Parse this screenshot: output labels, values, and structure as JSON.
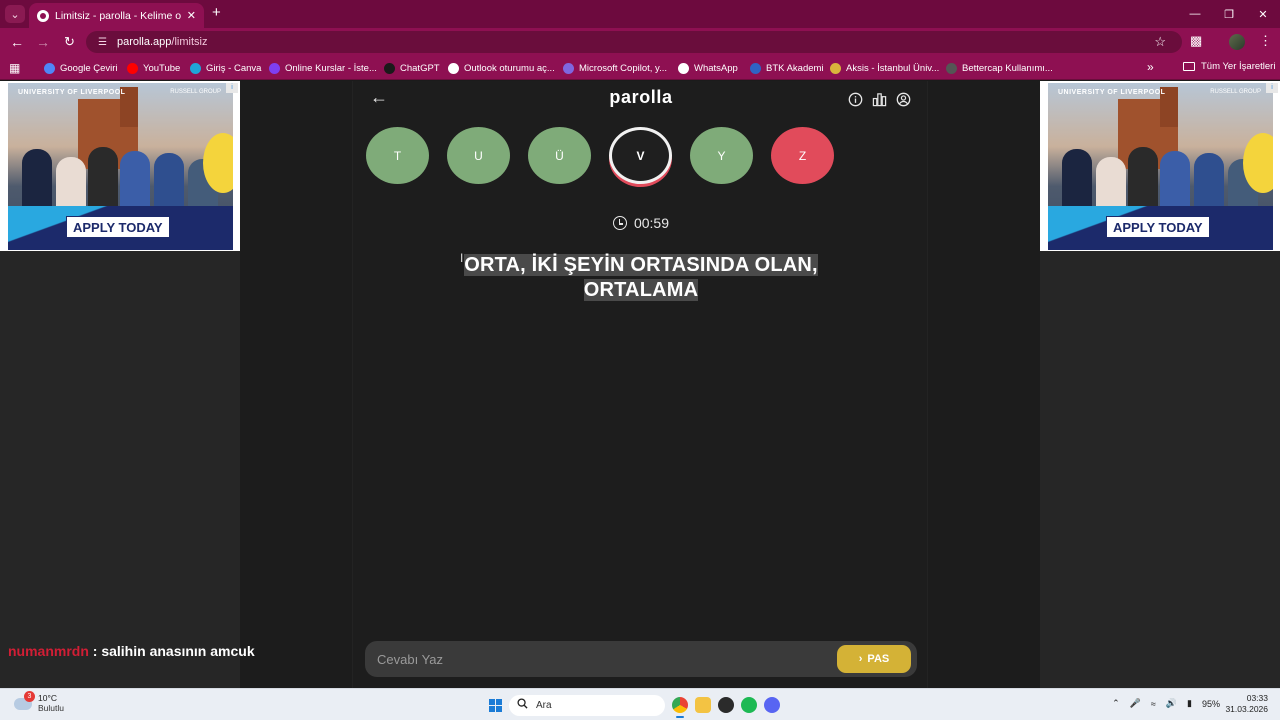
{
  "browser": {
    "tab_title": "Limitsiz - parolla - Kelime oyunu",
    "url_domain": "parolla.app",
    "url_path": "/limitsiz",
    "bookmarks": [
      {
        "label": "Google Çeviri",
        "color": "#4f86f7"
      },
      {
        "label": "YouTube",
        "color": "#ff0000"
      },
      {
        "label": "Giriş - Canva",
        "color": "#1fa5d8"
      },
      {
        "label": "Online Kurslar - İste...",
        "color": "#7e3ff2"
      },
      {
        "label": "ChatGPT",
        "color": "#1a1a1a"
      },
      {
        "label": "Outlook oturumu aç...",
        "color": "#ffffff"
      },
      {
        "label": "Microsoft Copilot, y...",
        "color": "#7f67e0"
      },
      {
        "label": "WhatsApp",
        "color": "#ffffff"
      },
      {
        "label": "BTK Akademi",
        "color": "#2f63c5"
      },
      {
        "label": "Aksis - İstanbul Üniv...",
        "color": "#d9b43c"
      },
      {
        "label": "Bettercap Kullanımı...",
        "color": "#555555"
      }
    ],
    "all_bookmarks": "Tüm Yer İşaretleri"
  },
  "ads": {
    "left": {
      "cta": "APPLY TODAY",
      "brand": "UNIVERSITY OF LIVERPOOL",
      "group": "RUSSELL GROUP"
    },
    "right": {
      "cta": "APPLY TODAY",
      "brand": "UNIVERSITY OF LIVERPOOL",
      "group": "RUSSELL GROUP"
    }
  },
  "game": {
    "brand": "parolla",
    "letters": [
      {
        "char": "T",
        "state": "correct"
      },
      {
        "char": "U",
        "state": "correct"
      },
      {
        "char": "Ü",
        "state": "correct"
      },
      {
        "char": "V",
        "state": "active"
      },
      {
        "char": "Y",
        "state": "correct"
      },
      {
        "char": "Z",
        "state": "wrong"
      }
    ],
    "timer": "00:59",
    "question_line1": "ORTA, İKİ ŞEYİN ORTASINDA OLAN,",
    "question_line2": "ORTALAMA",
    "answer_placeholder": "Cevabı Yaz",
    "pass_label": "PAS",
    "colors": {
      "correct": "#7fab79",
      "wrong": "#e14b5b",
      "pass": "#d4b236"
    }
  },
  "chat": {
    "user": "numanmrdn",
    "message": ": salihin anasının amcuk"
  },
  "taskbar": {
    "weather_badge": "3",
    "temperature": "10°C",
    "condition": "Bulutlu",
    "search_label": "Ara",
    "battery": "95%",
    "time": "03:33",
    "date": "31.03.2026"
  }
}
